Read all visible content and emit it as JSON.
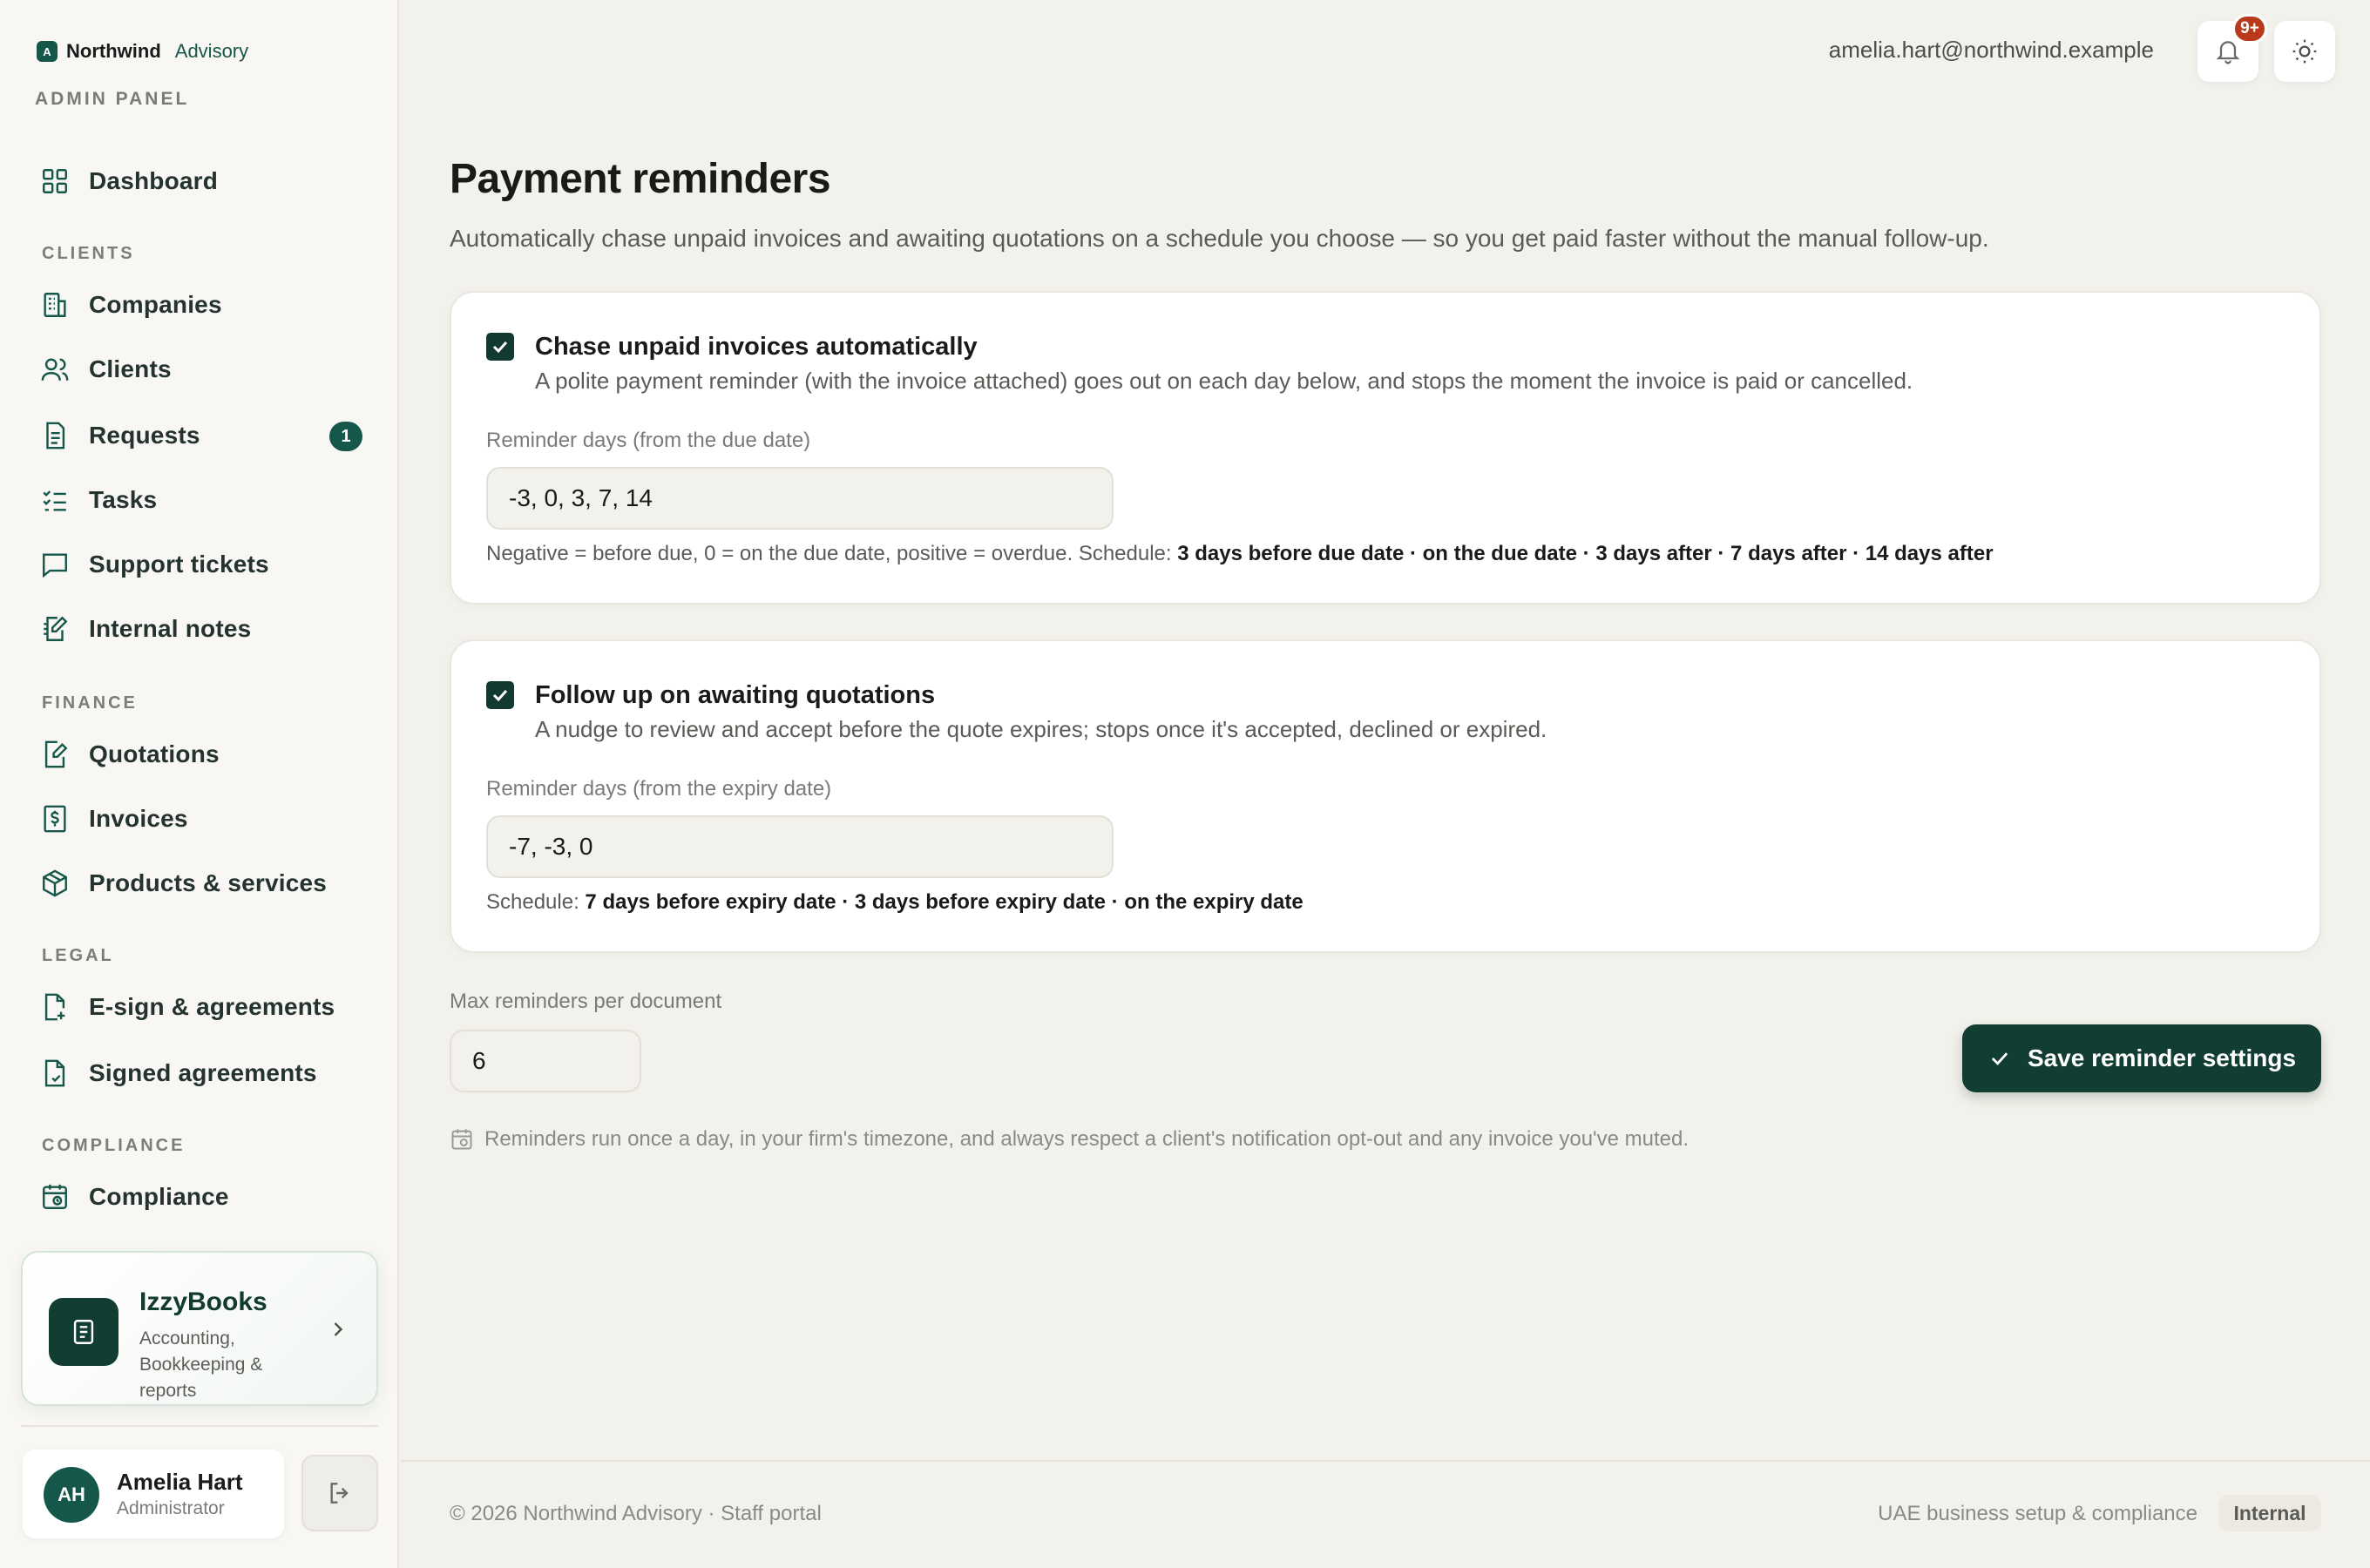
{
  "brand": {
    "logo_letter": "A",
    "name": "Northwind",
    "sub": "Advisory",
    "panel_label": "ADMIN PANEL"
  },
  "nav": {
    "dashboard": "Dashboard",
    "section_clients": "CLIENTS",
    "companies": "Companies",
    "clients": "Clients",
    "requests": "Requests",
    "requests_badge": "1",
    "tasks": "Tasks",
    "support_tickets": "Support tickets",
    "internal_notes": "Internal notes",
    "section_finance": "FINANCE",
    "quotations": "Quotations",
    "invoices": "Invoices",
    "products_services": "Products & services",
    "section_legal": "LEGAL",
    "esign": "E-sign & agreements",
    "signed_agreements": "Signed agreements",
    "section_compliance": "COMPLIANCE",
    "compliance": "Compliance"
  },
  "promo": {
    "title": "IzzyBooks",
    "desc": "Accounting, Bookkeeping & reports"
  },
  "user": {
    "initials": "AH",
    "name": "Amelia Hart",
    "role": "Administrator"
  },
  "topbar": {
    "email": "amelia.hart@northwind.example",
    "notif_count": "9+"
  },
  "page": {
    "title": "Payment reminders",
    "subtitle": "Automatically chase unpaid invoices and awaiting quotations on a schedule you choose — so you get paid faster without the manual follow-up."
  },
  "invoices_card": {
    "checked": true,
    "title": "Chase unpaid invoices automatically",
    "desc": "A polite payment reminder (with the invoice attached) goes out on each day below, and stops the moment the invoice is paid or cancelled.",
    "field_label": "Reminder days (from the due date)",
    "value": "-3, 0, 3, 7, 14",
    "hint_prefix": "Negative = before due, 0 = on the due date, positive = overdue. Schedule: ",
    "schedule": "3 days before due date · on the due date · 3 days after · 7 days after · 14 days after"
  },
  "quotations_card": {
    "checked": true,
    "title": "Follow up on awaiting quotations",
    "desc": "A nudge to review and accept before the quote expires; stops once it's accepted, declined or expired.",
    "field_label": "Reminder days (from the expiry date)",
    "value": "-7, -3, 0",
    "hint_prefix": "Schedule: ",
    "schedule": "7 days before expiry date · 3 days before expiry date · on the expiry date"
  },
  "max_reminders": {
    "label": "Max reminders per document",
    "value": "6"
  },
  "save_label": "Save reminder settings",
  "footnote": "Reminders run once a day, in your firm's timezone, and always respect a client's notification opt-out and any invoice you've muted.",
  "footer": {
    "left": "© 2026 Northwind Advisory · Staff portal",
    "right": "UAE business setup & compliance",
    "tag": "Internal"
  },
  "colors": {
    "accent": "#15574a",
    "accent_dark": "#123d32",
    "badge_red": "#b83a1a",
    "background": "#f3f1eb"
  },
  "icons": [
    "dashboard-icon",
    "companies-icon",
    "clients-icon",
    "requests-icon",
    "tasks-icon",
    "support-icon",
    "notes-icon",
    "quotations-icon",
    "invoices-icon",
    "products-icon",
    "esign-icon",
    "signed-icon",
    "compliance-icon",
    "book-icon",
    "chevron-right-icon",
    "logout-icon",
    "bell-icon",
    "sun-icon",
    "check-icon",
    "calendar-icon"
  ]
}
